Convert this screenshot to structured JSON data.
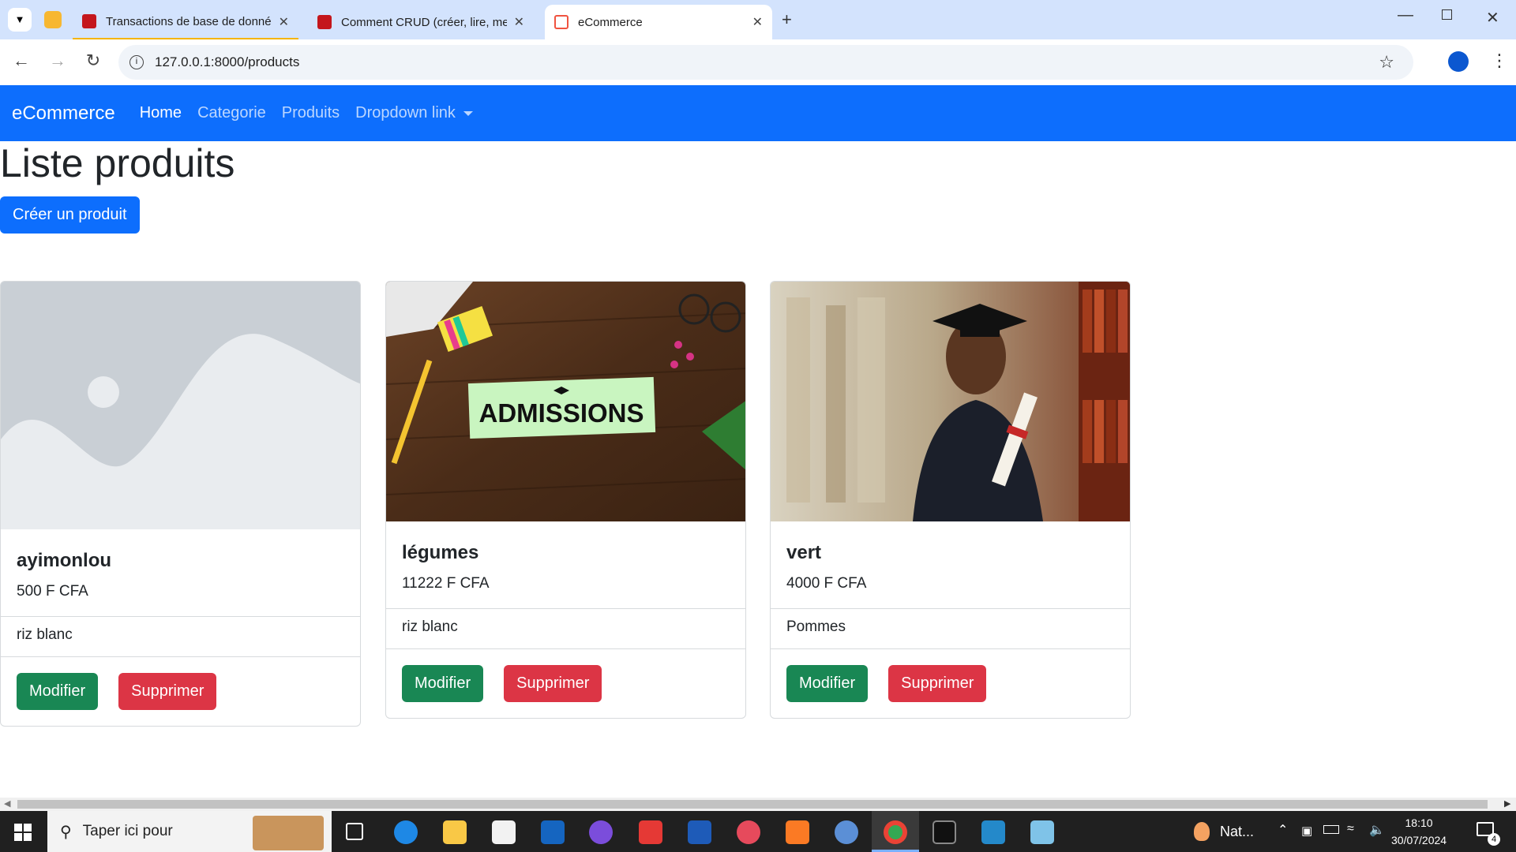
{
  "browser": {
    "tabs": [
      {
        "title": "Transactions de base de donné",
        "active": false
      },
      {
        "title": "Comment CRUD (créer, lire, me",
        "active": false
      },
      {
        "title": "eCommerce",
        "active": true
      }
    ],
    "url": "127.0.0.1:8000/products"
  },
  "navbar": {
    "brand": "eCommerce",
    "links": [
      "Home",
      "Categorie",
      "Produits",
      "Dropdown link"
    ]
  },
  "page": {
    "title": "Liste produits",
    "create_button": "Créer un produit"
  },
  "products": [
    {
      "name": "ayimonlou",
      "price": "500 F CFA",
      "description": "riz blanc",
      "image": "placeholder-image",
      "image_text": ""
    },
    {
      "name": "légumes",
      "price": "11222 F CFA",
      "description": "riz blanc",
      "image": "admissions-photo",
      "image_text": "ADMISSIONS"
    },
    {
      "name": "vert",
      "price": "4000 F CFA",
      "description": "Pommes",
      "image": "graduate-photo",
      "image_text": ""
    }
  ],
  "card_actions": {
    "edit": "Modifier",
    "delete": "Supprimer"
  },
  "taskbar": {
    "search_placeholder": "Taper ici pour",
    "weather": "Nat...",
    "time": "18:10",
    "date": "30/07/2024",
    "notifications": "4"
  },
  "colors": {
    "primary": "#0d6efd",
    "success": "#198754",
    "danger": "#dc3545"
  }
}
